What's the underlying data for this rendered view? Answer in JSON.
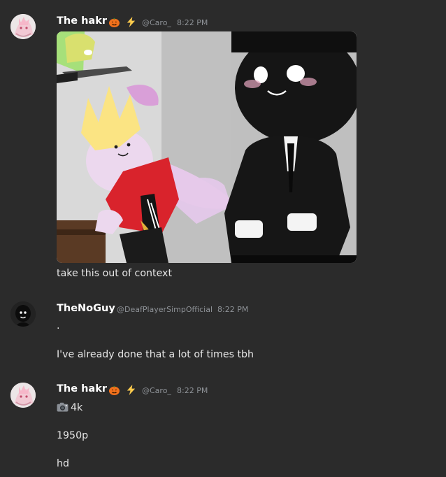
{
  "messages": [
    {
      "username": "The hakr",
      "badges": [
        "pumpkin-icon",
        "lightning-icon"
      ],
      "handle": "@Caro_",
      "time": "8:22 PM",
      "attachment": "image",
      "lines": [
        "take this out of context"
      ]
    },
    {
      "username": "TheNoGuy",
      "badges": [],
      "handle": "@DeafPlayerSimpOfficial",
      "time": "8:22 PM",
      "lines": [
        ".",
        "I've already done that  a lot of times tbh"
      ]
    },
    {
      "username": "The hakr",
      "badges": [
        "pumpkin-icon",
        "lightning-icon"
      ],
      "handle": "@Caro_",
      "time": "8:22 PM",
      "lines": [
        "4k",
        "1950p",
        "hd"
      ],
      "first_line_icon": "camera-icon"
    }
  ],
  "colors": {
    "background": "#2b2b2b",
    "username": "#ffffff",
    "meta": "#8e9297",
    "text": "#e6e6e6"
  }
}
